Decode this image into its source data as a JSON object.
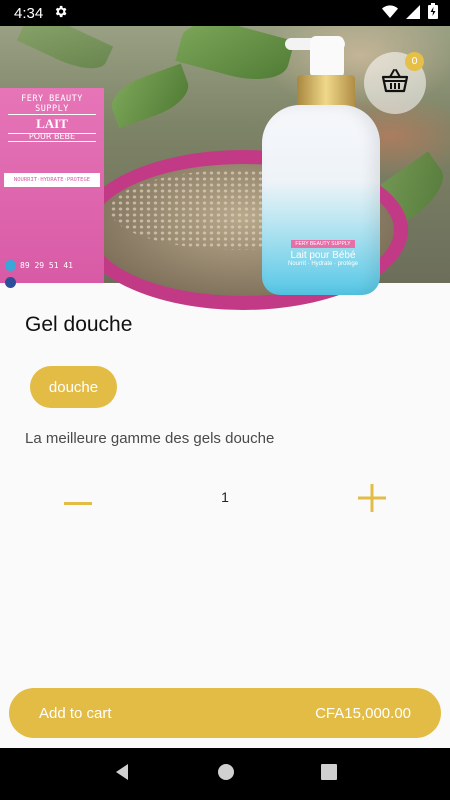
{
  "status_bar": {
    "time": "4:34",
    "icons": [
      "gear-icon",
      "wifi-icon",
      "cellular-signal-icon",
      "battery-icon"
    ]
  },
  "hero": {
    "image_description_icons": [
      "product-photo"
    ],
    "sign": {
      "brand": "FERY BEAUTY SUPPLY",
      "line1": "LAIT",
      "line2": "POUR BEBE",
      "strip": "NOURRIT·HYDRATE·PROTEGE",
      "phone": "89 29 51 41"
    },
    "bottle_label": {
      "brand": "FERY BEAUTY SUPPLY",
      "name": "Lait pour Bébé",
      "tagline": "Nourrit · Hydrate · protège"
    }
  },
  "cart": {
    "badge_count": "0",
    "icon": "basket-icon"
  },
  "product": {
    "title": "Gel douche",
    "category_chip": "douche",
    "description": "La meilleure gamme des gels douche"
  },
  "quantity": {
    "value": "1",
    "decrement_icon": "minus-icon",
    "increment_icon": "plus-icon"
  },
  "add_to_cart": {
    "label": "Add to cart",
    "price": "CFA15,000.00"
  },
  "nav_bar": {
    "icons": [
      "back-icon",
      "home-icon",
      "recents-icon"
    ]
  },
  "colors": {
    "accent": "#e3bc45",
    "status_bar": "#000000",
    "background": "#fafafa"
  }
}
